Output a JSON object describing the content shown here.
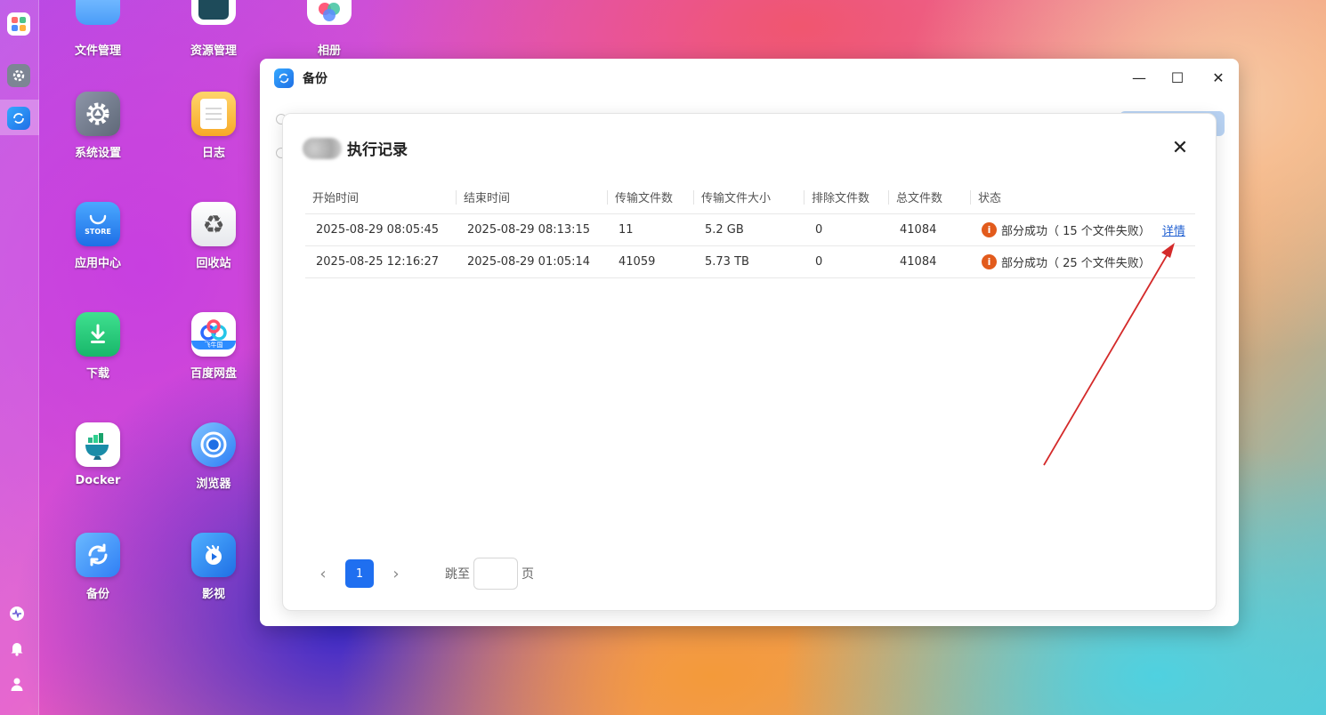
{
  "desktop": {
    "icons": [
      {
        "label": "文件管理"
      },
      {
        "label": "资源管理"
      },
      {
        "label": "相册"
      },
      {
        "label": "系统设置"
      },
      {
        "label": "日志"
      },
      {
        "label": "应用中心",
        "badge": "STORE"
      },
      {
        "label": "回收站"
      },
      {
        "label": "下载"
      },
      {
        "label": "百度网盘",
        "badge": "飞牛国"
      },
      {
        "label": "Docker"
      },
      {
        "label": "浏览器"
      },
      {
        "label": "备份"
      },
      {
        "label": "影视"
      }
    ]
  },
  "window": {
    "title": "备份",
    "controls": {
      "minimize": "—",
      "maximize": "☐",
      "close": "✕"
    }
  },
  "dialog": {
    "title": "执行记录",
    "close": "✕",
    "columns": [
      "开始时间",
      "结束时间",
      "传输文件数",
      "传输文件大小",
      "排除文件数",
      "总文件数",
      "状态"
    ],
    "rows": [
      {
        "start": "2025-08-29 08:05:45",
        "end": "2025-08-29 08:13:15",
        "files": "11",
        "size": "5.2 GB",
        "excluded": "0",
        "total": "41084",
        "status": "部分成功（ 15 个文件失败）",
        "detail": "详情"
      },
      {
        "start": "2025-08-25 12:16:27",
        "end": "2025-08-29 01:05:14",
        "files": "41059",
        "size": "5.73 TB",
        "excluded": "0",
        "total": "41084",
        "status": "部分成功（ 25 个文件失败）",
        "detail": ""
      }
    ],
    "pager": {
      "prev": "‹",
      "current": "1",
      "next": "›",
      "jump_label": "跳至",
      "jump_value": "",
      "page_label": "页"
    }
  },
  "colors": {
    "accent": "#1f6ff0",
    "warning": "#e25b1c",
    "link": "#1f5fd1",
    "annotation_arrow": "#d42a2a"
  }
}
